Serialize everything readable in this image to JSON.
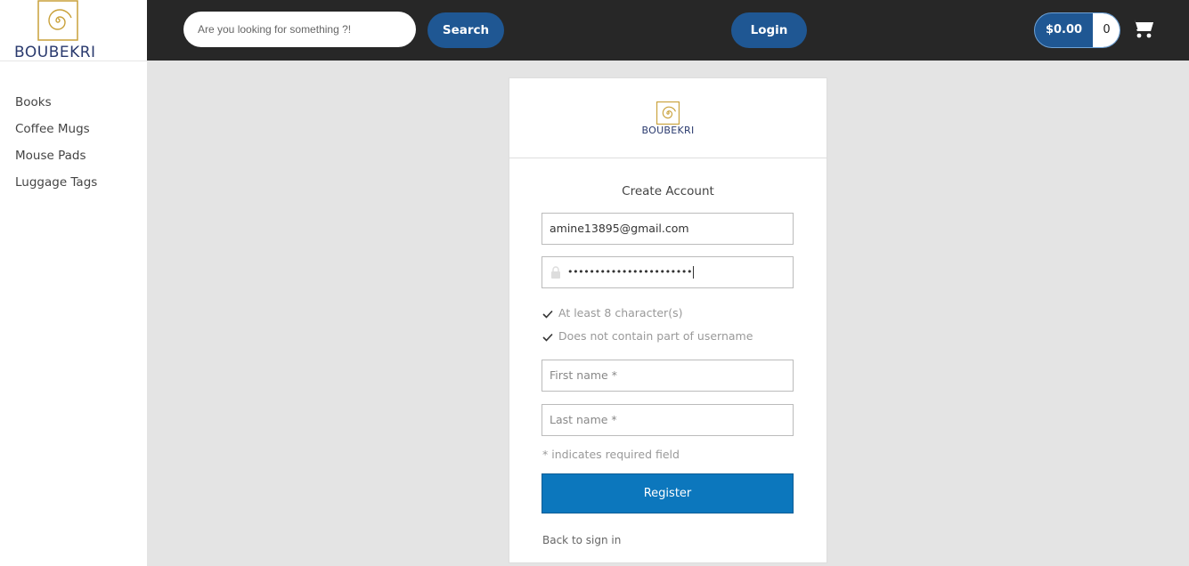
{
  "brand": {
    "name": "BOUBEKRI"
  },
  "sidebar": {
    "categories": [
      {
        "label": "Books"
      },
      {
        "label": "Coffee Mugs"
      },
      {
        "label": "Mouse Pads"
      },
      {
        "label": "Luggage Tags"
      }
    ]
  },
  "header": {
    "search_placeholder": "Are you looking for something ?!",
    "search_label": "Search",
    "login_label": "Login",
    "cart_total": "$0.00",
    "cart_count": "0",
    "cart_icon": "shopping-cart-icon"
  },
  "form": {
    "brand": "BOUBEKRI",
    "title": "Create Account",
    "email_value": "amine13895@gmail.com",
    "password_mask": "•••••••••••••••••••••••",
    "rules": [
      {
        "text": "At least 8 character(s)",
        "met": true
      },
      {
        "text": "Does not contain part of username",
        "met": true
      }
    ],
    "first_name_placeholder": "First name *",
    "last_name_placeholder": "Last name *",
    "required_note": "* indicates required field",
    "register_label": "Register",
    "back_link": "Back to sign in"
  },
  "colors": {
    "accent": "#1f5793",
    "register": "#0c77bd",
    "topbar": "#272727",
    "logo_gold": "#c9a13a",
    "brand_navy": "#2a3a6e"
  }
}
